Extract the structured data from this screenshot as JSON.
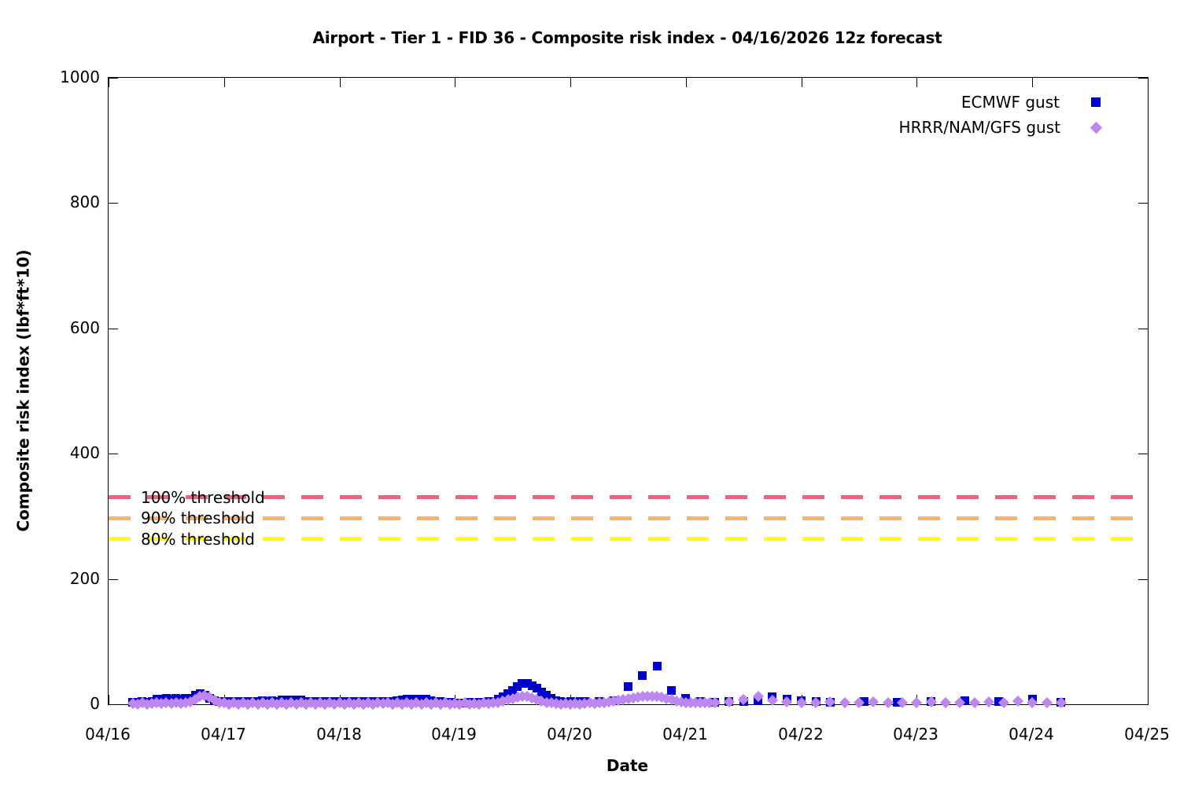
{
  "title": "Airport - Tier 1 - FID 36 - Composite risk index - 04/16/2026 12z forecast",
  "axes": {
    "x": {
      "label": "Date",
      "ticks": [
        "04/16",
        "04/17",
        "04/18",
        "04/19",
        "04/20",
        "04/21",
        "04/22",
        "04/23",
        "04/24",
        "04/25"
      ]
    },
    "y": {
      "label": "Composite risk index (lbf*ft*10)",
      "ticks": [
        "0",
        "200",
        "400",
        "600",
        "800",
        "1000"
      ],
      "tick_values": [
        0,
        200,
        400,
        600,
        800,
        1000
      ],
      "lim": [
        0,
        1000
      ]
    }
  },
  "legend": {
    "items": [
      {
        "label": "ECMWF gust",
        "marker": "square",
        "color": "#0000cc"
      },
      {
        "label": "HRRR/NAM/GFS gust",
        "marker": "diamond",
        "color": "#bd87f0"
      }
    ]
  },
  "thresholds": [
    {
      "label": "100% threshold",
      "value": 330,
      "color": "#e06880"
    },
    {
      "label": "90% threshold",
      "value": 297,
      "color": "#f9b466"
    },
    {
      "label": "80% threshold",
      "value": 264,
      "color": "#ffff00"
    }
  ],
  "chart_data": {
    "type": "scatter",
    "title": "Airport - Tier 1 - FID 36 - Composite risk index - 04/16/2026 12z forecast",
    "xlabel": "Date",
    "ylabel": "Composite risk index (lbf*ft*10)",
    "xlim": [
      "04/16",
      "04/25"
    ],
    "ylim": [
      0,
      1000
    ],
    "x_unit": "hours since 04/16 00:00",
    "grid": false,
    "legend_position": "top-right",
    "series": [
      {
        "name": "ECMWF gust",
        "marker": "square",
        "color": "#0000cc",
        "points": [
          [
            5,
            3
          ],
          [
            6,
            3
          ],
          [
            7,
            4
          ],
          [
            8,
            3
          ],
          [
            9,
            4
          ],
          [
            10,
            8
          ],
          [
            11,
            8
          ],
          [
            12,
            9
          ],
          [
            13,
            8
          ],
          [
            14,
            9
          ],
          [
            15,
            8
          ],
          [
            16,
            9
          ],
          [
            17,
            10
          ],
          [
            18,
            14
          ],
          [
            19,
            17
          ],
          [
            20,
            15
          ],
          [
            21,
            10
          ],
          [
            22,
            6
          ],
          [
            23,
            4
          ],
          [
            24,
            5
          ],
          [
            25,
            4
          ],
          [
            26,
            5
          ],
          [
            27,
            4
          ],
          [
            28,
            5
          ],
          [
            29,
            5
          ],
          [
            30,
            4
          ],
          [
            31,
            5
          ],
          [
            32,
            6
          ],
          [
            33,
            5
          ],
          [
            34,
            6
          ],
          [
            35,
            5
          ],
          [
            36,
            7
          ],
          [
            37,
            7
          ],
          [
            38,
            7
          ],
          [
            39,
            7
          ],
          [
            40,
            7
          ],
          [
            41,
            5
          ],
          [
            42,
            5
          ],
          [
            43,
            4
          ],
          [
            44,
            5
          ],
          [
            45,
            4
          ],
          [
            46,
            5
          ],
          [
            47,
            4
          ],
          [
            48,
            4
          ],
          [
            49,
            5
          ],
          [
            50,
            4
          ],
          [
            51,
            5
          ],
          [
            52,
            4
          ],
          [
            53,
            5
          ],
          [
            54,
            4
          ],
          [
            55,
            5
          ],
          [
            56,
            5
          ],
          [
            57,
            5
          ],
          [
            58,
            4
          ],
          [
            59,
            5
          ],
          [
            60,
            6
          ],
          [
            61,
            7
          ],
          [
            62,
            8
          ],
          [
            63,
            8
          ],
          [
            64,
            8
          ],
          [
            65,
            8
          ],
          [
            66,
            8
          ],
          [
            67,
            6
          ],
          [
            68,
            4
          ],
          [
            69,
            4
          ],
          [
            70,
            3
          ],
          [
            71,
            3
          ],
          [
            72,
            2
          ],
          [
            73,
            2
          ],
          [
            74,
            2
          ],
          [
            75,
            3
          ],
          [
            76,
            2
          ],
          [
            77,
            3
          ],
          [
            78,
            3
          ],
          [
            79,
            4
          ],
          [
            80,
            5
          ],
          [
            81,
            8
          ],
          [
            82,
            12
          ],
          [
            83,
            17
          ],
          [
            84,
            22
          ],
          [
            85,
            28
          ],
          [
            86,
            33
          ],
          [
            87,
            33
          ],
          [
            88,
            30
          ],
          [
            89,
            26
          ],
          [
            90,
            20
          ],
          [
            91,
            14
          ],
          [
            92,
            9
          ],
          [
            93,
            6
          ],
          [
            94,
            4
          ],
          [
            95,
            3
          ],
          [
            96,
            4
          ],
          [
            97,
            3
          ],
          [
            98,
            4
          ],
          [
            99,
            4
          ],
          [
            102,
            5
          ],
          [
            105,
            6
          ],
          [
            108,
            28
          ],
          [
            111,
            46
          ],
          [
            114,
            61
          ],
          [
            117,
            22
          ],
          [
            120,
            10
          ],
          [
            123,
            4
          ],
          [
            126,
            3
          ],
          [
            129,
            4
          ],
          [
            132,
            5
          ],
          [
            135,
            6
          ],
          [
            138,
            12
          ],
          [
            141,
            8
          ],
          [
            144,
            6
          ],
          [
            147,
            4
          ],
          [
            150,
            3
          ],
          [
            157,
            4
          ],
          [
            164,
            3
          ],
          [
            171,
            4
          ],
          [
            178,
            6
          ],
          [
            185,
            4
          ],
          [
            192,
            8
          ],
          [
            198,
            3
          ]
        ]
      },
      {
        "name": "HRRR/NAM/GFS gust",
        "marker": "diamond",
        "color": "#bd87f0",
        "points": [
          [
            5,
            1
          ],
          [
            6,
            0
          ],
          [
            7,
            2
          ],
          [
            8,
            0
          ],
          [
            9,
            1
          ],
          [
            10,
            2
          ],
          [
            11,
            1
          ],
          [
            12,
            3
          ],
          [
            13,
            1
          ],
          [
            14,
            2
          ],
          [
            15,
            1
          ],
          [
            16,
            2
          ],
          [
            17,
            4
          ],
          [
            18,
            8
          ],
          [
            19,
            12
          ],
          [
            20,
            14
          ],
          [
            21,
            11
          ],
          [
            22,
            6
          ],
          [
            23,
            3
          ],
          [
            24,
            2
          ],
          [
            25,
            0
          ],
          [
            26,
            3
          ],
          [
            27,
            0
          ],
          [
            28,
            2
          ],
          [
            29,
            0
          ],
          [
            30,
            3
          ],
          [
            31,
            0
          ],
          [
            32,
            2
          ],
          [
            33,
            0
          ],
          [
            34,
            3
          ],
          [
            35,
            0
          ],
          [
            36,
            2
          ],
          [
            37,
            0
          ],
          [
            38,
            3
          ],
          [
            39,
            0
          ],
          [
            40,
            2
          ],
          [
            41,
            0
          ],
          [
            42,
            3
          ],
          [
            43,
            0
          ],
          [
            44,
            2
          ],
          [
            45,
            0
          ],
          [
            46,
            3
          ],
          [
            47,
            0
          ],
          [
            48,
            2
          ],
          [
            49,
            0
          ],
          [
            50,
            3
          ],
          [
            51,
            0
          ],
          [
            52,
            2
          ],
          [
            53,
            0
          ],
          [
            54,
            3
          ],
          [
            55,
            0
          ],
          [
            56,
            2
          ],
          [
            57,
            1
          ],
          [
            58,
            3
          ],
          [
            59,
            0
          ],
          [
            60,
            2
          ],
          [
            61,
            0
          ],
          [
            62,
            3
          ],
          [
            63,
            0
          ],
          [
            64,
            2
          ],
          [
            65,
            0
          ],
          [
            66,
            3
          ],
          [
            67,
            0
          ],
          [
            68,
            2
          ],
          [
            69,
            0
          ],
          [
            70,
            2
          ],
          [
            71,
            0
          ],
          [
            72,
            1
          ],
          [
            73,
            0
          ],
          [
            74,
            2
          ],
          [
            75,
            0
          ],
          [
            76,
            1
          ],
          [
            77,
            0
          ],
          [
            78,
            2
          ],
          [
            79,
            1
          ],
          [
            80,
            2
          ],
          [
            81,
            3
          ],
          [
            82,
            5
          ],
          [
            83,
            7
          ],
          [
            84,
            9
          ],
          [
            85,
            11
          ],
          [
            86,
            12
          ],
          [
            87,
            12
          ],
          [
            88,
            10
          ],
          [
            89,
            8
          ],
          [
            90,
            5
          ],
          [
            91,
            3
          ],
          [
            92,
            2
          ],
          [
            93,
            1
          ],
          [
            94,
            0
          ],
          [
            95,
            1
          ],
          [
            96,
            0
          ],
          [
            97,
            1
          ],
          [
            98,
            0
          ],
          [
            99,
            1
          ],
          [
            100,
            2
          ],
          [
            101,
            1
          ],
          [
            102,
            2
          ],
          [
            103,
            3
          ],
          [
            104,
            4
          ],
          [
            105,
            5
          ],
          [
            106,
            6
          ],
          [
            107,
            7
          ],
          [
            108,
            9
          ],
          [
            109,
            10
          ],
          [
            110,
            11
          ],
          [
            111,
            12
          ],
          [
            112,
            13
          ],
          [
            113,
            12
          ],
          [
            114,
            12
          ],
          [
            115,
            11
          ],
          [
            116,
            9
          ],
          [
            117,
            7
          ],
          [
            118,
            5
          ],
          [
            119,
            4
          ],
          [
            120,
            3
          ],
          [
            121,
            2
          ],
          [
            122,
            3
          ],
          [
            123,
            2
          ],
          [
            124,
            2
          ],
          [
            125,
            2
          ],
          [
            126,
            3
          ],
          [
            129,
            4
          ],
          [
            132,
            8
          ],
          [
            135,
            12
          ],
          [
            138,
            6
          ],
          [
            141,
            4
          ],
          [
            144,
            3
          ],
          [
            147,
            3
          ],
          [
            150,
            4
          ],
          [
            153,
            3
          ],
          [
            156,
            3
          ],
          [
            159,
            4
          ],
          [
            162,
            3
          ],
          [
            165,
            3
          ],
          [
            168,
            3
          ],
          [
            171,
            4
          ],
          [
            174,
            3
          ],
          [
            177,
            3
          ],
          [
            180,
            3
          ],
          [
            183,
            4
          ],
          [
            186,
            3
          ],
          [
            189,
            5
          ],
          [
            192,
            3
          ],
          [
            195,
            3
          ],
          [
            198,
            2
          ]
        ]
      }
    ],
    "threshold_lines": [
      {
        "label": "100% threshold",
        "value": 330,
        "color": "#e06880",
        "style": "dashed"
      },
      {
        "label": "90% threshold",
        "value": 297,
        "color": "#f9b466",
        "style": "dashed"
      },
      {
        "label": "80% threshold",
        "value": 264,
        "color": "#ffff00",
        "style": "dashed"
      }
    ]
  }
}
